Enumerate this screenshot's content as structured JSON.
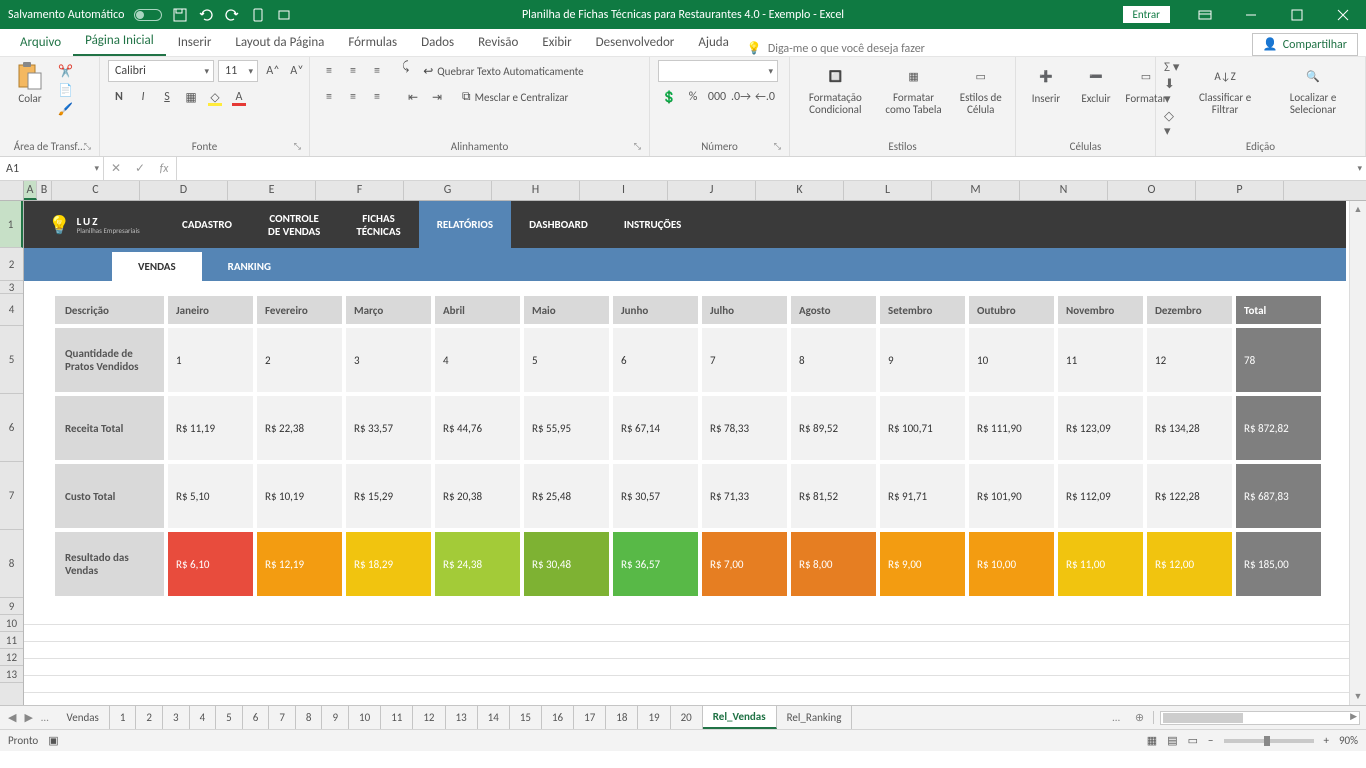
{
  "titlebar": {
    "autosave": "Salvamento Automático",
    "title": "Planilha de Fichas Técnicas para Restaurantes 4.0 - Exemplo  -  Excel",
    "signin": "Entrar"
  },
  "menu": {
    "file": "Arquivo",
    "home": "Página Inicial",
    "insert": "Inserir",
    "layout": "Layout da Página",
    "formulas": "Fórmulas",
    "data": "Dados",
    "review": "Revisão",
    "view": "Exibir",
    "dev": "Desenvolvedor",
    "help": "Ajuda",
    "tell": "Diga-me o que você deseja fazer",
    "share": "Compartilhar"
  },
  "ribbon": {
    "clipboard": {
      "label": "Área de Transf…",
      "paste": "Colar"
    },
    "font": {
      "label": "Fonte",
      "name": "Calibri",
      "size": "11",
      "bold": "N",
      "italic": "I",
      "underline": "S"
    },
    "align": {
      "label": "Alinhamento",
      "wrap": "Quebrar Texto Automaticamente",
      "merge": "Mesclar e Centralizar"
    },
    "number": {
      "label": "Número"
    },
    "styles": {
      "label": "Estilos",
      "cond": "Formatação Condicional",
      "table": "Formatar como Tabela",
      "cell": "Estilos de Célula"
    },
    "cells": {
      "label": "Células",
      "insert": "Inserir",
      "delete": "Excluir",
      "format": "Formatar"
    },
    "editing": {
      "label": "Edição",
      "sort": "Classificar e Filtrar",
      "find": "Localizar e Selecionar"
    }
  },
  "formula": {
    "namebox": "A1",
    "fx": "fx"
  },
  "columns": [
    "A",
    "B",
    "C",
    "D",
    "E",
    "F",
    "G",
    "H",
    "I",
    "J",
    "K",
    "L",
    "M",
    "N",
    "O",
    "P"
  ],
  "rows": [
    "1",
    "2",
    "3",
    "4",
    "5",
    "6",
    "7",
    "8",
    "9",
    "10",
    "11",
    "12",
    "13"
  ],
  "appnav": {
    "logo_brand": "LUZ",
    "logo_sub": "Planilhas Empresariais",
    "items": [
      "CADASTRO",
      "CONTROLE\nDE VENDAS",
      "FICHAS\nTÉCNICAS",
      "RELATÓRIOS",
      "DASHBOARD",
      "INSTRUÇÕES"
    ],
    "selected": 3
  },
  "subtabs": {
    "items": [
      "VENDAS",
      "RANKING"
    ],
    "selected": 0
  },
  "table": {
    "desc_header": "Descrição",
    "months": [
      "Janeiro",
      "Fevereiro",
      "Março",
      "Abril",
      "Maio",
      "Junho",
      "Julho",
      "Agosto",
      "Setembro",
      "Outubro",
      "Novembro",
      "Dezembro"
    ],
    "total_header": "Total",
    "rows": [
      {
        "label": "Quantidade de Pratos Vendidos",
        "values": [
          "1",
          "2",
          "3",
          "4",
          "5",
          "6",
          "7",
          "8",
          "9",
          "10",
          "11",
          "12"
        ],
        "total": "78"
      },
      {
        "label": "Receita Total",
        "values": [
          "R$ 11,19",
          "R$ 22,38",
          "R$ 33,57",
          "R$ 44,76",
          "R$ 55,95",
          "R$ 67,14",
          "R$ 78,33",
          "R$ 89,52",
          "R$ 100,71",
          "R$ 111,90",
          "R$ 123,09",
          "R$ 134,28"
        ],
        "total": "R$ 872,82"
      },
      {
        "label": "Custo Total",
        "values": [
          "R$ 5,10",
          "R$ 10,19",
          "R$ 15,29",
          "R$ 20,38",
          "R$ 25,48",
          "R$ 30,57",
          "R$ 71,33",
          "R$ 81,52",
          "R$ 91,71",
          "R$ 101,90",
          "R$ 112,09",
          "R$ 122,28"
        ],
        "total": "R$ 687,83"
      },
      {
        "label": "Resultado das Vendas",
        "values": [
          "R$ 6,10",
          "R$ 12,19",
          "R$ 18,29",
          "R$ 24,38",
          "R$ 30,48",
          "R$ 36,57",
          "R$ 7,00",
          "R$ 8,00",
          "R$ 9,00",
          "R$ 10,00",
          "R$ 11,00",
          "R$ 12,00"
        ],
        "total": "R$ 185,00",
        "colors": [
          "#e84c3d",
          "#f39c11",
          "#f1c40f",
          "#a3cb38",
          "#7eb233",
          "#58b947",
          "#e67e22",
          "#e67e22",
          "#f39c11",
          "#f39c11",
          "#f1c40f",
          "#f1c40f"
        ]
      }
    ]
  },
  "sheets": {
    "items": [
      "Vendas",
      "1",
      "2",
      "3",
      "4",
      "5",
      "6",
      "7",
      "8",
      "9",
      "10",
      "11",
      "12",
      "13",
      "14",
      "15",
      "16",
      "17",
      "18",
      "19",
      "20",
      "Rel_Vendas",
      "Rel_Ranking"
    ],
    "active": "Rel_Vendas",
    "more": "…"
  },
  "status": {
    "ready": "Pronto",
    "zoom": "90%"
  }
}
